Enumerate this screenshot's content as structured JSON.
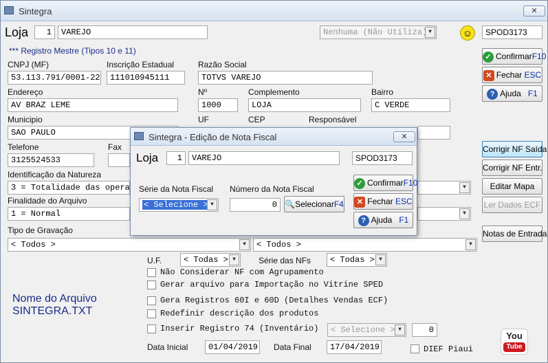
{
  "window": {
    "title": "Sintegra",
    "close_label": "✕"
  },
  "loja": {
    "label": "Loja",
    "number": "1",
    "name": "VAREJO"
  },
  "combo_nenhuma": "Nenhuma (Não Utiliza)",
  "user_code": "SPOD3173",
  "registro_mestre": "*** Registro Mestre (Tipos 10 e 11)",
  "fields": {
    "cnpj": {
      "label": "CNPJ (MF)",
      "value": "53.113.791/0001-22"
    },
    "ie": {
      "label": "Inscrição Estadual",
      "value": "111010945111"
    },
    "razao": {
      "label": "Razão Social",
      "value": "TOTVS VAREJO"
    },
    "endereco": {
      "label": "Endereço",
      "value": "AV BRAZ LEME"
    },
    "numero": {
      "label": "Nº",
      "value": "1000"
    },
    "complemento": {
      "label": "Complemento",
      "value": "LOJA"
    },
    "bairro": {
      "label": "Bairro",
      "value": "C VERDE"
    },
    "municipio": {
      "label": "Municipio",
      "value": "SAO PAULO"
    },
    "uf": {
      "label": "UF"
    },
    "cep": {
      "label": "CEP"
    },
    "responsavel": {
      "label": "Responsável"
    },
    "telefone": {
      "label": "Telefone",
      "value": "3125524533"
    },
    "fax": {
      "label": "Fax"
    },
    "natureza": {
      "label": "Identificação da Natureza",
      "value": "3 = Totalidade das operaç"
    },
    "finalidade": {
      "label": "Finalidade do Arquivo",
      "value": "1 = Normal"
    },
    "gravacao": {
      "label": "Tipo de Gravação",
      "value1": "< Todos >",
      "value2": "< Todos >"
    },
    "uf2": {
      "label": "U.F.",
      "value": "< Todas >"
    },
    "serie_nfs": {
      "label": "Série das NFs",
      "value": "< Todas >"
    }
  },
  "checkboxes": [
    "Não Considerar NF com Agrupamento",
    "Gerar arquivo para Importação no Vitrine SPED",
    "Gera Registros 60I e 60D (Detalhes Vendas ECF)",
    "Redefinir descrição dos produtos",
    "Inserir Registro 74 (Inventário)"
  ],
  "reg74": {
    "select": "< Selecione >",
    "value": "0"
  },
  "arquivo": {
    "label": "Nome do Arquivo",
    "name": "SINTEGRA.TXT"
  },
  "datas": {
    "inicial_label": "Data Inicial",
    "inicial": "01/04/2019",
    "final_label": "Data Final",
    "final": "17/04/2019"
  },
  "dief": "DIEF Piaui",
  "buttons": {
    "confirmar": "Confirmar",
    "confirmar_key": "F10",
    "fechar": "Fechar",
    "fechar_key": "ESC",
    "ajuda": "Ajuda",
    "ajuda_key": "F1",
    "corrigir_saida": "Corrigir NF Saída",
    "corrigir_entr": "Corrigir NF Entr.",
    "editar_mapa": "Editar Mapa",
    "ler_ecf": "Ler Dados ECF",
    "notas_entrada": "Notas de Entrada"
  },
  "youtube": {
    "line1": "You",
    "line2": "Tube"
  },
  "dialog": {
    "title": "Sintegra - Edição de Nota Fiscal",
    "loja_label": "Loja",
    "loja_num": "1",
    "loja_name": "VAREJO",
    "code": "SPOD3173",
    "serie_label": "Série da Nota Fiscal",
    "serie_value": "< Selecione >",
    "numero_label": "Número da Nota Fiscal",
    "numero_value": "0",
    "selecionar": "Selecionar",
    "selecionar_key": "F4",
    "confirmar": "Confirmar",
    "confirmar_key": "F10",
    "fechar": "Fechar",
    "fechar_key": "ESC",
    "ajuda": "Ajuda",
    "ajuda_key": "F1"
  }
}
